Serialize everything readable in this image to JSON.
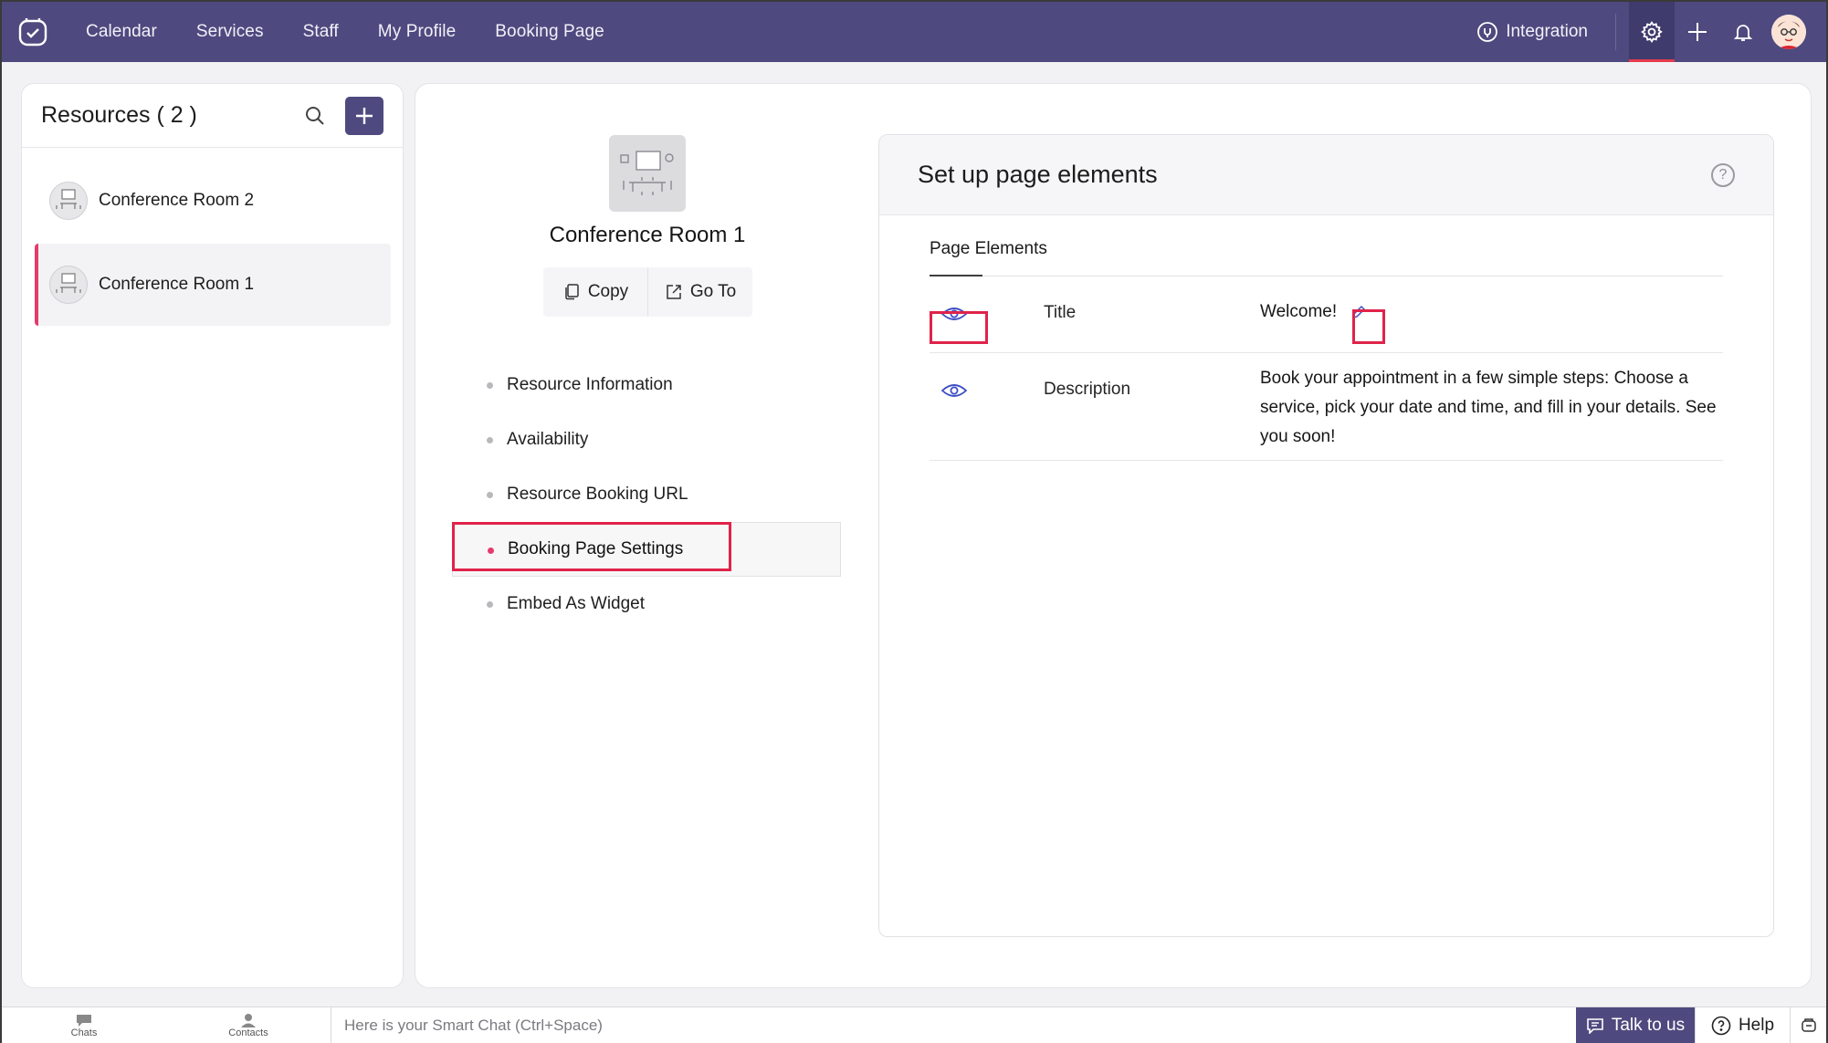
{
  "nav": {
    "links": [
      "Calendar",
      "Services",
      "Staff",
      "My Profile",
      "Booking Page"
    ],
    "integration_label": "Integration",
    "accent_color": "#4e4a7f",
    "active_indicator_color": "#e63b4a"
  },
  "resources": {
    "title": "Resources ( 2 )",
    "items": [
      {
        "name": "Conference Room 2",
        "selected": false
      },
      {
        "name": "Conference Room 1",
        "selected": true
      }
    ]
  },
  "detail": {
    "name": "Conference Room 1",
    "copy_label": "Copy",
    "goto_label": "Go To",
    "menu": [
      {
        "label": "Resource Information",
        "active": false
      },
      {
        "label": "Availability",
        "active": false
      },
      {
        "label": "Resource Booking URL",
        "active": false
      },
      {
        "label": "Booking Page Settings",
        "active": true
      },
      {
        "label": "Embed As Widget",
        "active": false
      }
    ]
  },
  "page_elements": {
    "heading": "Set up page elements",
    "help_glyph": "?",
    "tab_label": "Page Elements",
    "rows": [
      {
        "label": "Title",
        "value": "Welcome!",
        "visible": true
      },
      {
        "label": "Description",
        "value": "Book your appointment in a few simple steps: Choose a service, pick your date and time, and fill in your details. See you soon!",
        "visible": true
      }
    ]
  },
  "bottom_bar": {
    "chats_label": "Chats",
    "contacts_label": "Contacts",
    "smart_chat_placeholder": "Here is your Smart Chat (Ctrl+Space)",
    "talk_label": "Talk to us",
    "help_label": "Help"
  }
}
